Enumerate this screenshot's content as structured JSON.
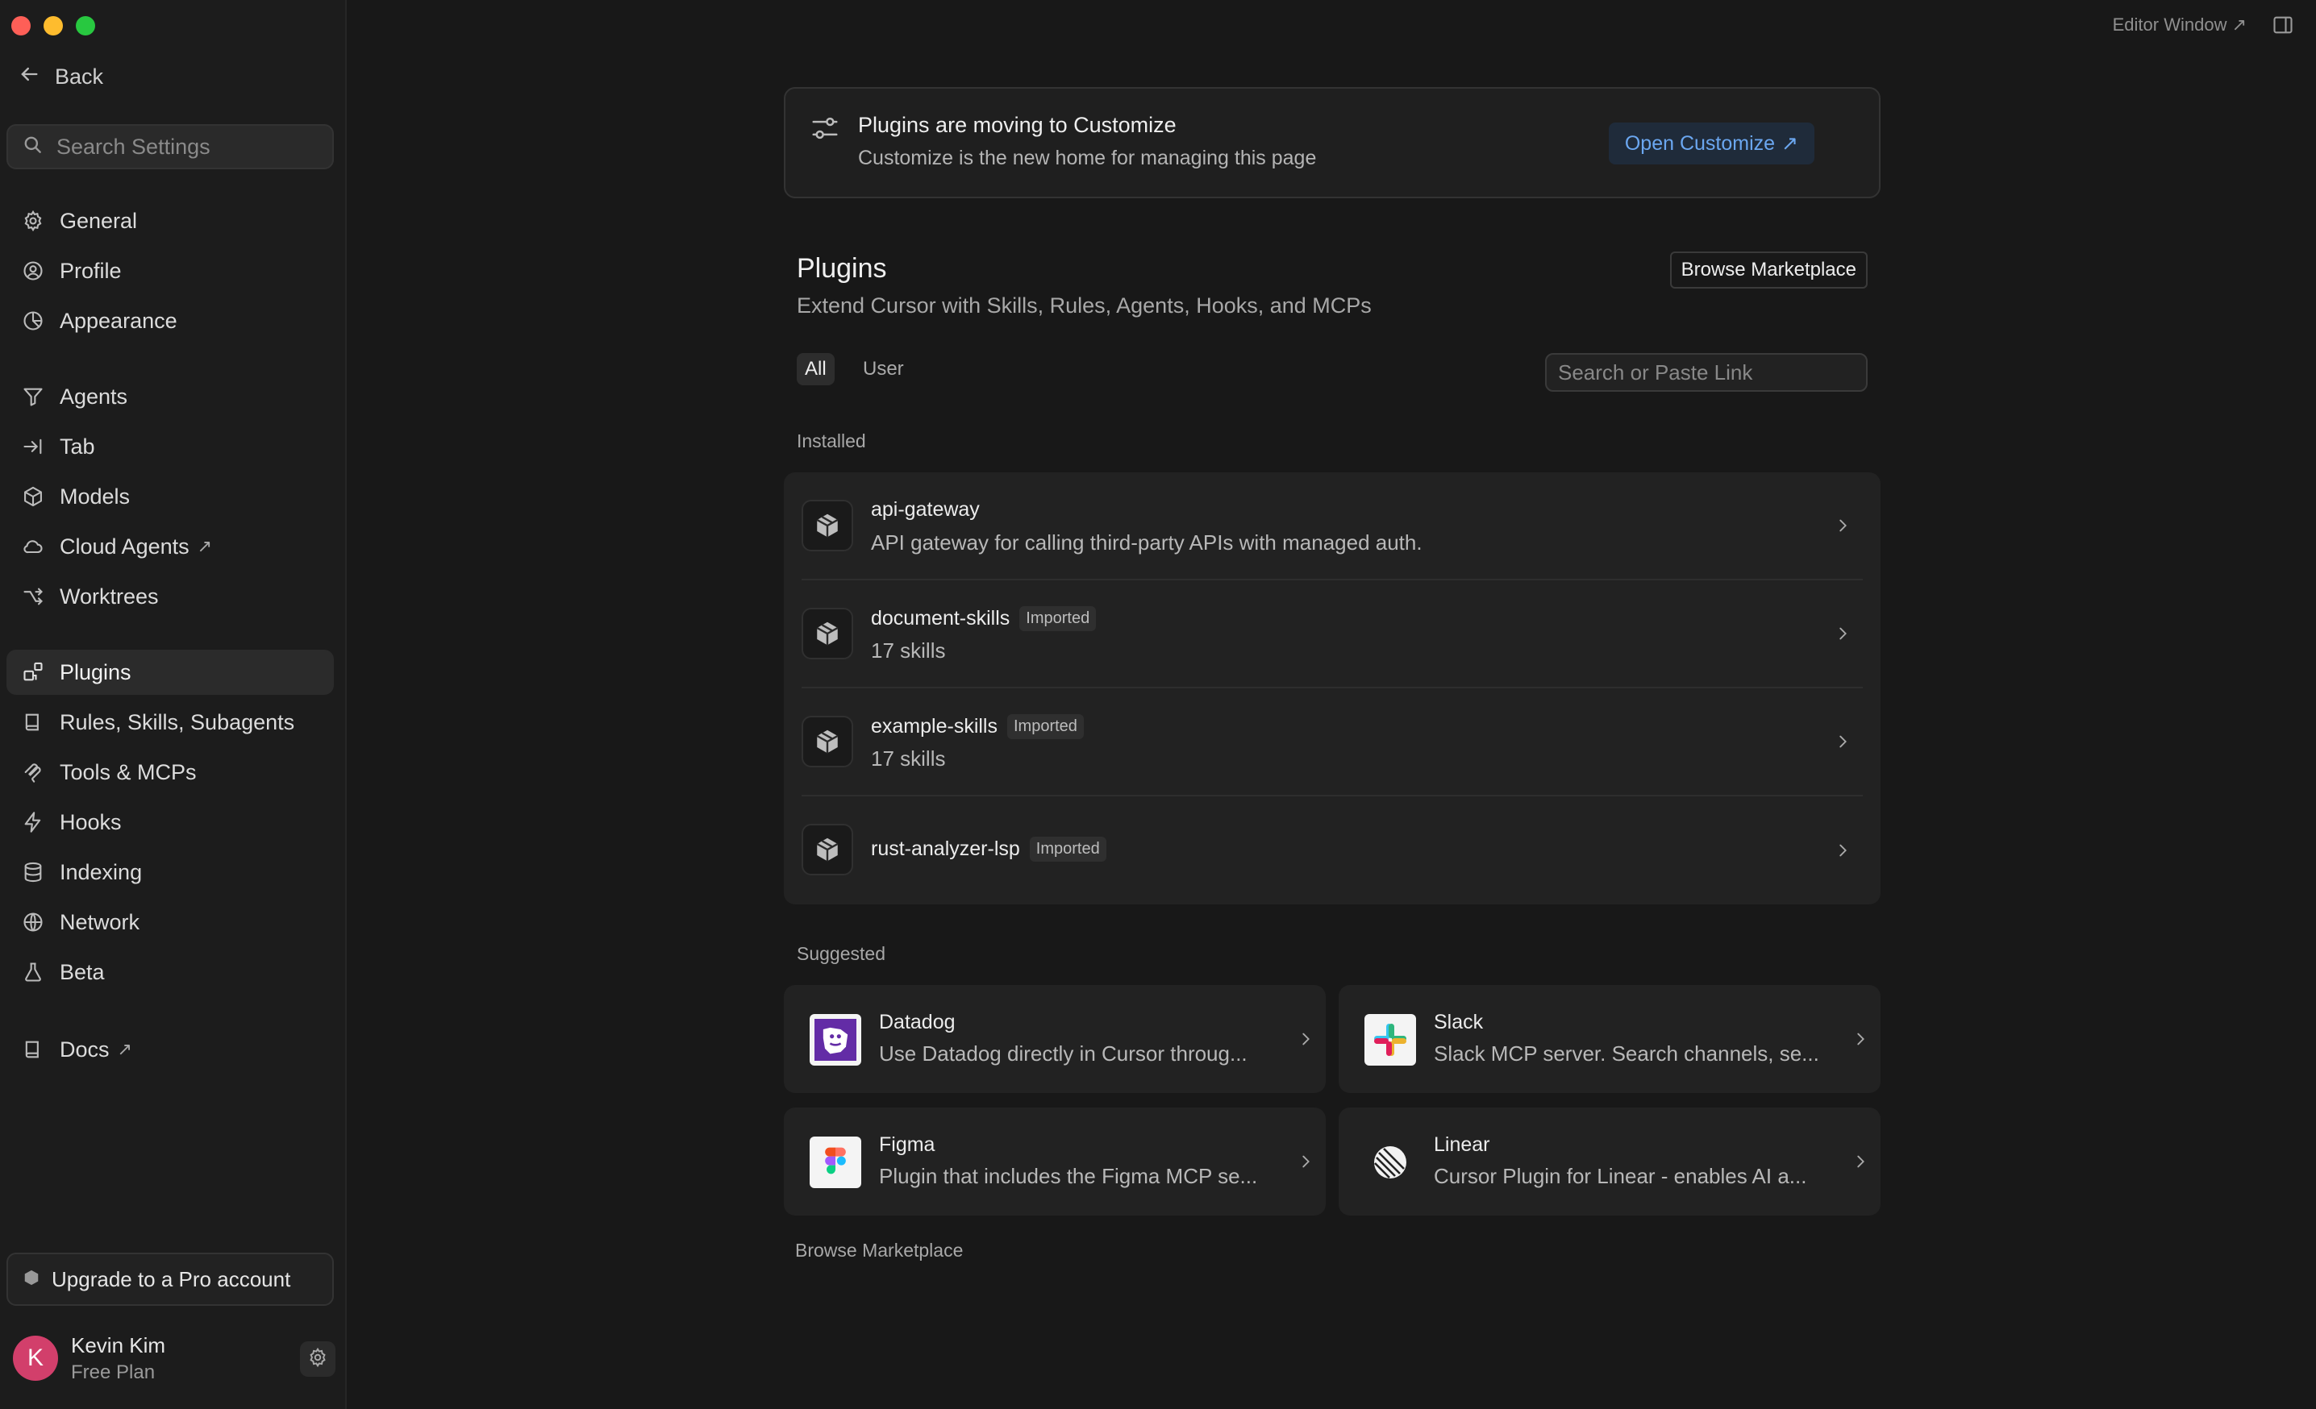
{
  "header": {
    "editor_window": "Editor Window ↗"
  },
  "sidebar": {
    "back_label": "Back",
    "search_placeholder": "Search Settings",
    "items": [
      {
        "label": "General"
      },
      {
        "label": "Profile"
      },
      {
        "label": "Appearance"
      },
      {
        "label": "Agents"
      },
      {
        "label": "Tab"
      },
      {
        "label": "Models"
      },
      {
        "label": "Cloud Agents"
      },
      {
        "label": "Worktrees"
      },
      {
        "label": "Plugins"
      },
      {
        "label": "Rules, Skills, Subagents"
      },
      {
        "label": "Tools & MCPs"
      },
      {
        "label": "Hooks"
      },
      {
        "label": "Indexing"
      },
      {
        "label": "Network"
      },
      {
        "label": "Beta"
      },
      {
        "label": "Docs"
      }
    ],
    "upgrade_label": "Upgrade to a Pro account",
    "user": {
      "initial": "K",
      "name": "Kevin Kim",
      "plan": "Free Plan"
    }
  },
  "banner": {
    "title": "Plugins are moving to Customize",
    "subtitle": "Customize is the new home for managing this page",
    "button": "Open Customize"
  },
  "plugins": {
    "title": "Plugins",
    "subtitle": "Extend Cursor with Skills, Rules, Agents, Hooks, and MCPs",
    "browse_button": "Browse Marketplace",
    "filters": {
      "all": "All",
      "user": "User"
    },
    "search_placeholder": "Search or Paste Link",
    "installed_label": "Installed",
    "installed": [
      {
        "name": "api-gateway",
        "badge": "",
        "desc": "API gateway for calling third-party APIs with managed auth."
      },
      {
        "name": "document-skills",
        "badge": "Imported",
        "desc": "17 skills"
      },
      {
        "name": "example-skills",
        "badge": "Imported",
        "desc": "17 skills"
      },
      {
        "name": "rust-analyzer-lsp",
        "badge": "Imported",
        "desc": ""
      }
    ],
    "suggested_label": "Suggested",
    "suggested": [
      {
        "name": "Datadog",
        "desc": "Use Datadog directly in Cursor throug..."
      },
      {
        "name": "Slack",
        "desc": "Slack MCP server. Search channels, se..."
      },
      {
        "name": "Figma",
        "desc": "Plugin that includes the Figma MCP se..."
      },
      {
        "name": "Linear",
        "desc": "Cursor Plugin for Linear - enables AI a..."
      }
    ],
    "browse_link": "Browse Marketplace"
  },
  "colors": {
    "background": "#181818",
    "sidebar": "#1c1c1c",
    "card": "#222222",
    "accent_link": "#6ba7f0",
    "avatar": "#d23f6b"
  }
}
